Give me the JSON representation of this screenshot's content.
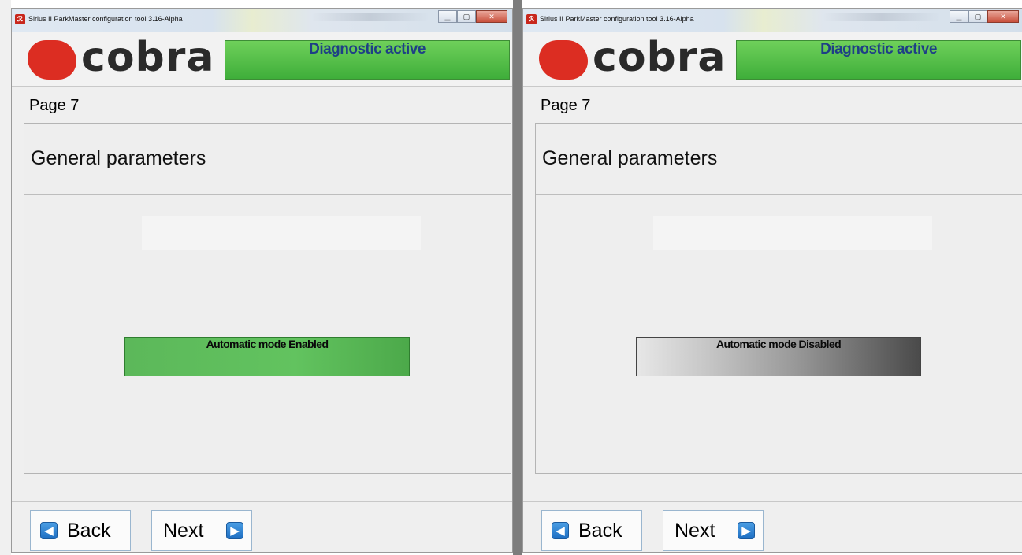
{
  "windows": [
    {
      "title": "Sirius II ParkMaster configuration tool  3.16-Alpha",
      "status": "Diagnostic active",
      "page": "Page 7",
      "section_title": "General parameters",
      "mode_button": "Automatic mode Enabled",
      "mode_state": "enabled",
      "back_label": "Back",
      "next_label": "Next",
      "logo": "cobra"
    },
    {
      "title": "Sirius II ParkMaster configuration tool  3.16-Alpha",
      "status": "Diagnostic active",
      "page": "Page 7",
      "section_title": "General parameters",
      "mode_button": "Automatic mode Disabled",
      "mode_state": "disabled",
      "back_label": "Back",
      "next_label": "Next",
      "logo": "cobra"
    }
  ],
  "colors": {
    "status_green": "#4cbb45",
    "status_text": "#1e3f86",
    "logo_red": "#dc2d22",
    "enabled_green": "#5cb85a",
    "disabled_dark": "#4a4a4a"
  },
  "icons": [
    "app-icon",
    "minimize-icon",
    "maximize-icon",
    "close-icon",
    "arrow-left-icon",
    "arrow-right-icon"
  ]
}
